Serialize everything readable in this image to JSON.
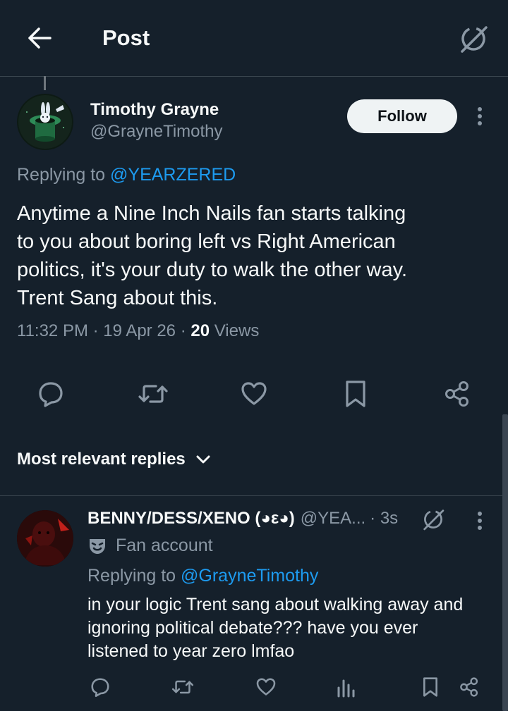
{
  "header": {
    "title": "Post"
  },
  "post": {
    "author_name": "Timothy Grayne",
    "author_handle": "@GrayneTimothy",
    "follow_label": "Follow",
    "replying_prefix": "Replying to ",
    "replying_to": "@YEARZERED",
    "text_lines": [
      "Anytime a Nine Inch Nails fan starts talking",
      "to you about boring left vs Right American",
      "politics, it's your duty to walk the other way.",
      "Trent Sang about this."
    ],
    "time": "11:32 PM",
    "date": "19 Apr 26",
    "views_count": "20",
    "views_label": "Views"
  },
  "replies_section": {
    "sort_label": "Most relevant replies"
  },
  "reply": {
    "author_name": "BENNY/DESS/XENO (◕ε◕)",
    "author_handle": "@YEA...",
    "time": "3s",
    "badge_label": "Fan account",
    "replying_prefix": "Replying to ",
    "replying_to": "@GrayneTimothy",
    "text_lines": [
      "in your logic Trent sang about walking away and",
      "ignoring political debate??? have you ever",
      "listened to year zero lmfao"
    ]
  },
  "colors": {
    "background": "#15202b",
    "accent": "#1d9bf0",
    "muted": "#8b98a5"
  },
  "icons": [
    "back-arrow-icon",
    "grok-icon",
    "more-vertical-icon",
    "reply-icon",
    "repost-icon",
    "like-icon",
    "bookmark-icon",
    "share-icon",
    "chevron-down-icon",
    "fan-mask-icon",
    "views-icon"
  ]
}
